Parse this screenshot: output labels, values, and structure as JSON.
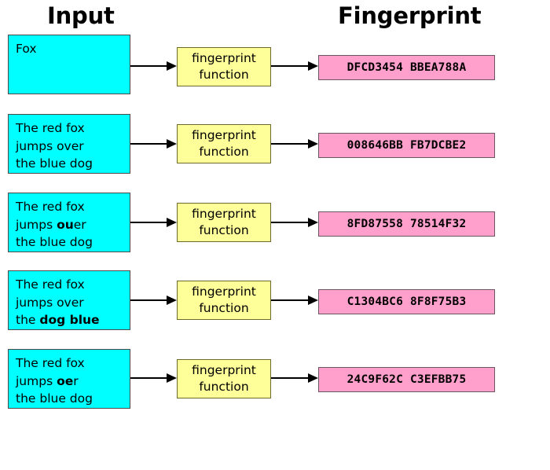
{
  "headers": {
    "input": "Input",
    "fingerprint": "Fingerprint"
  },
  "function_box": {
    "line1": "fingerprint",
    "line2": "function"
  },
  "colors": {
    "input_box_fill": "#00FFFF",
    "function_box_fill": "#FFFF99",
    "hash_box_fill": "#FF9FCB",
    "text": "#000000",
    "background": "#FFFFFF",
    "arrow": "#000000"
  },
  "rows": [
    {
      "input_lines": [
        {
          "plain": "Fox",
          "bold": "",
          "tail": ""
        }
      ],
      "input_text": "Fox",
      "hash": "DFCD3454 BBEA788A",
      "fn_line1": "fingerprint",
      "fn_line2": "function"
    },
    {
      "input_lines": [
        {
          "plain": "The red fox",
          "bold": "",
          "tail": ""
        },
        {
          "plain": "jumps over",
          "bold": "",
          "tail": ""
        },
        {
          "plain": "the blue dog",
          "bold": "",
          "tail": ""
        }
      ],
      "input_text": "The red fox jumps over the blue dog",
      "hash": "008646BB FB7DCBE2",
      "fn_line1": "fingerprint",
      "fn_line2": "function"
    },
    {
      "input_lines": [
        {
          "plain": "The red fox",
          "bold": "",
          "tail": ""
        },
        {
          "plain": "jumps ",
          "bold": "ou",
          "tail": "er"
        },
        {
          "plain": "the blue dog",
          "bold": "",
          "tail": ""
        }
      ],
      "input_text": "The red fox jumps ouer the blue dog",
      "hash": "8FD87558 78514F32",
      "fn_line1": "fingerprint",
      "fn_line2": "function"
    },
    {
      "input_lines": [
        {
          "plain": "The red fox",
          "bold": "",
          "tail": ""
        },
        {
          "plain": "jumps over",
          "bold": "",
          "tail": ""
        },
        {
          "plain": "the ",
          "bold": "dog blue",
          "tail": ""
        }
      ],
      "input_text": "The red fox jumps over the dog blue",
      "hash": "C1304BC6 8F8F75B3",
      "fn_line1": "fingerprint",
      "fn_line2": "function"
    },
    {
      "input_lines": [
        {
          "plain": "The red fox",
          "bold": "",
          "tail": ""
        },
        {
          "plain": "jumps ",
          "bold": "oe",
          "tail": "r"
        },
        {
          "plain": "the blue dog",
          "bold": "",
          "tail": ""
        }
      ],
      "input_text": "The red fox jumps oer the blue dog",
      "hash": "24C9F62C C3EFBB75",
      "fn_line1": "fingerprint",
      "fn_line2": "function"
    }
  ]
}
